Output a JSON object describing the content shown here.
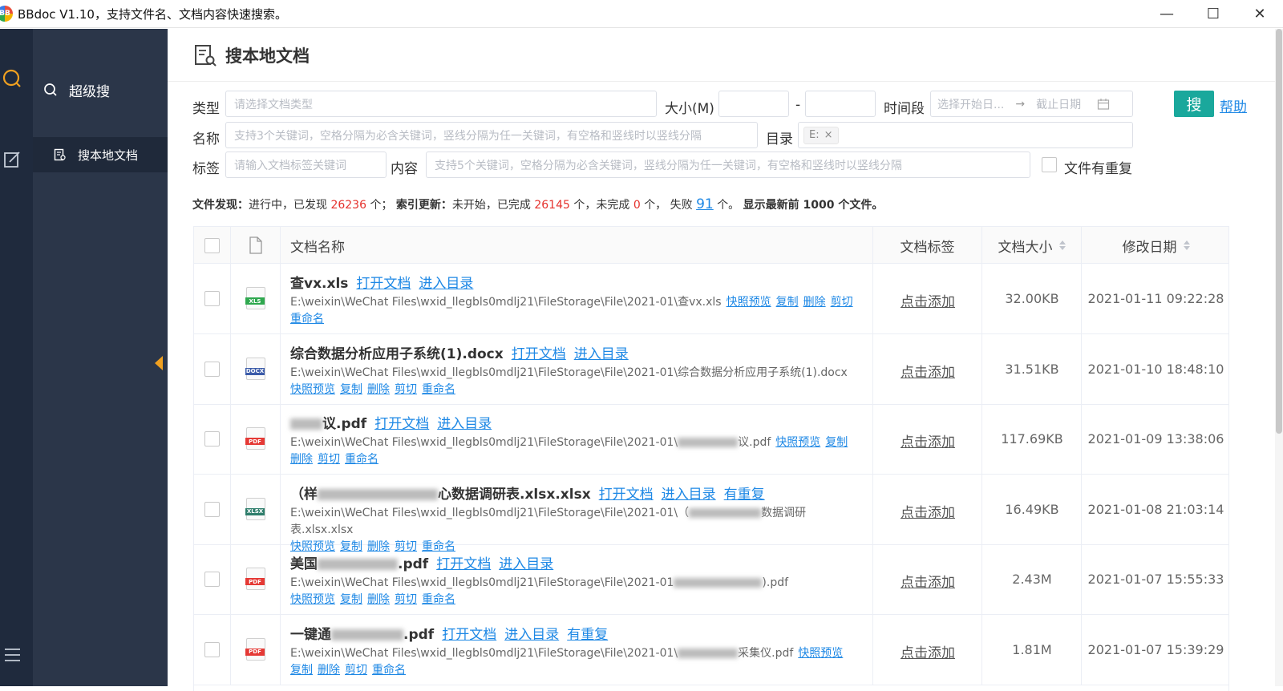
{
  "window": {
    "title": "BBdoc V1.10，支持文件名、文档内容快速搜索。",
    "logo_text": "BB",
    "minimize": "—",
    "maximize": "☐",
    "close": "✕"
  },
  "sidebar": {
    "section": "超级搜",
    "item": "搜本地文档"
  },
  "page": {
    "title": "搜本地文档"
  },
  "form": {
    "type_label": "类型",
    "type_placeholder": "请选择文档类型",
    "size_label": "大小(M)",
    "size_sep": "-",
    "period_label": "时间段",
    "start_placeholder": "选择开始日...",
    "range_arrow": "→",
    "end_placeholder": "截止日期",
    "search_button": "搜",
    "help_link": "帮助",
    "name_label": "名称",
    "name_placeholder": "支持3个关键词，空格分隔为必含关键词，竖线分隔为任一关键词，有空格和竖线时以竖线分隔",
    "dir_label": "目录",
    "dir_chip": "E:",
    "chip_close": "×",
    "tag_label": "标签",
    "tag_placeholder": "请输入文档标签关键词",
    "content_label": "内容",
    "content_placeholder": "支持5个关键词，空格分隔为必含关键词，竖线分隔为任一关键词，有空格和竖线时以竖线分隔",
    "dup_label": "文件有重复"
  },
  "status": {
    "discover_label": "文件发现：",
    "discover_text": "进行中，已发现",
    "found": "26236",
    "unit1": "个；",
    "index_label": "索引更新：",
    "index_text": "未开始，已完成",
    "done": "26145",
    "unit2": "个，未完成",
    "pending": "0",
    "unit3": "个，  失败",
    "failed": "91",
    "unit4": "个。",
    "tail": "显示最新前 1000 个文件。"
  },
  "table": {
    "headers": {
      "name": "文档名称",
      "tag": "文档标签",
      "size": "文档大小",
      "date": "修改日期"
    },
    "actions": {
      "open": "打开文档",
      "dir": "进入目录",
      "dup": "有重复",
      "preview": "快照预览",
      "copy": "复制",
      "delete": "删除",
      "cut": "剪切",
      "rename": "重命名",
      "add_tag": "点击添加"
    },
    "rows": [
      {
        "name": "查vx.xls",
        "path": "E:\\weixin\\WeChat Files\\wxid_llegbls0mdlj21\\FileStorage\\File\\2021-01\\查vx.xls",
        "size": "32.00KB",
        "date": "2021-01-11 09:22:28",
        "icon": "XLS",
        "color": "#2fa84f"
      },
      {
        "name": "综合数据分析应用子系统(1).docx",
        "path": "E:\\weixin\\WeChat Files\\wxid_llegbls0mdlj21\\FileStorage\\File\\2021-01\\综合数据分析应用子系统(1).docx",
        "size": "31.51KB",
        "date": "2021-01-10 18:48:10",
        "icon": "DOCX",
        "color": "#3b5ba9"
      },
      {
        "name_a": "",
        "name_b": "议.pdf",
        "path_a": "E:\\weixin\\WeChat Files\\wxid_llegbls0mdlj21\\FileStorage\\File\\2021-01\\",
        "path_b": "议.pdf",
        "size": "117.69KB",
        "date": "2021-01-09 13:38:06",
        "icon": "PDF",
        "color": "#e53935"
      },
      {
        "name_a": "（样",
        "name_b": "心数据调研表.xlsx.xlsx",
        "path_a": "E:\\weixin\\WeChat Files\\wxid_llegbls0mdlj21\\FileStorage\\File\\2021-01\\（",
        "path_b": "数据调研表.xlsx.xlsx",
        "size": "16.49KB",
        "date": "2021-01-08 21:03:14",
        "icon": "XLSX",
        "color": "#2e7d6b"
      },
      {
        "name_a": "美国",
        "name_b": ".pdf",
        "path_a": "E:\\weixin\\WeChat Files\\wxid_llegbls0mdlj21\\FileStorage\\File\\2021-01",
        "path_b": ").pdf",
        "size": "2.43M",
        "date": "2021-01-07 15:55:33",
        "icon": "PDF",
        "color": "#e53935"
      },
      {
        "name_a": "一键通",
        "name_b": ".pdf",
        "path_a": "E:\\weixin\\WeChat Files\\wxid_llegbls0mdlj21\\FileStorage\\File\\2021-01\\",
        "path_b": "采集仪.pdf",
        "size": "1.81M",
        "date": "2021-01-07 15:39:29",
        "icon": "PDF",
        "color": "#e53935"
      }
    ]
  }
}
